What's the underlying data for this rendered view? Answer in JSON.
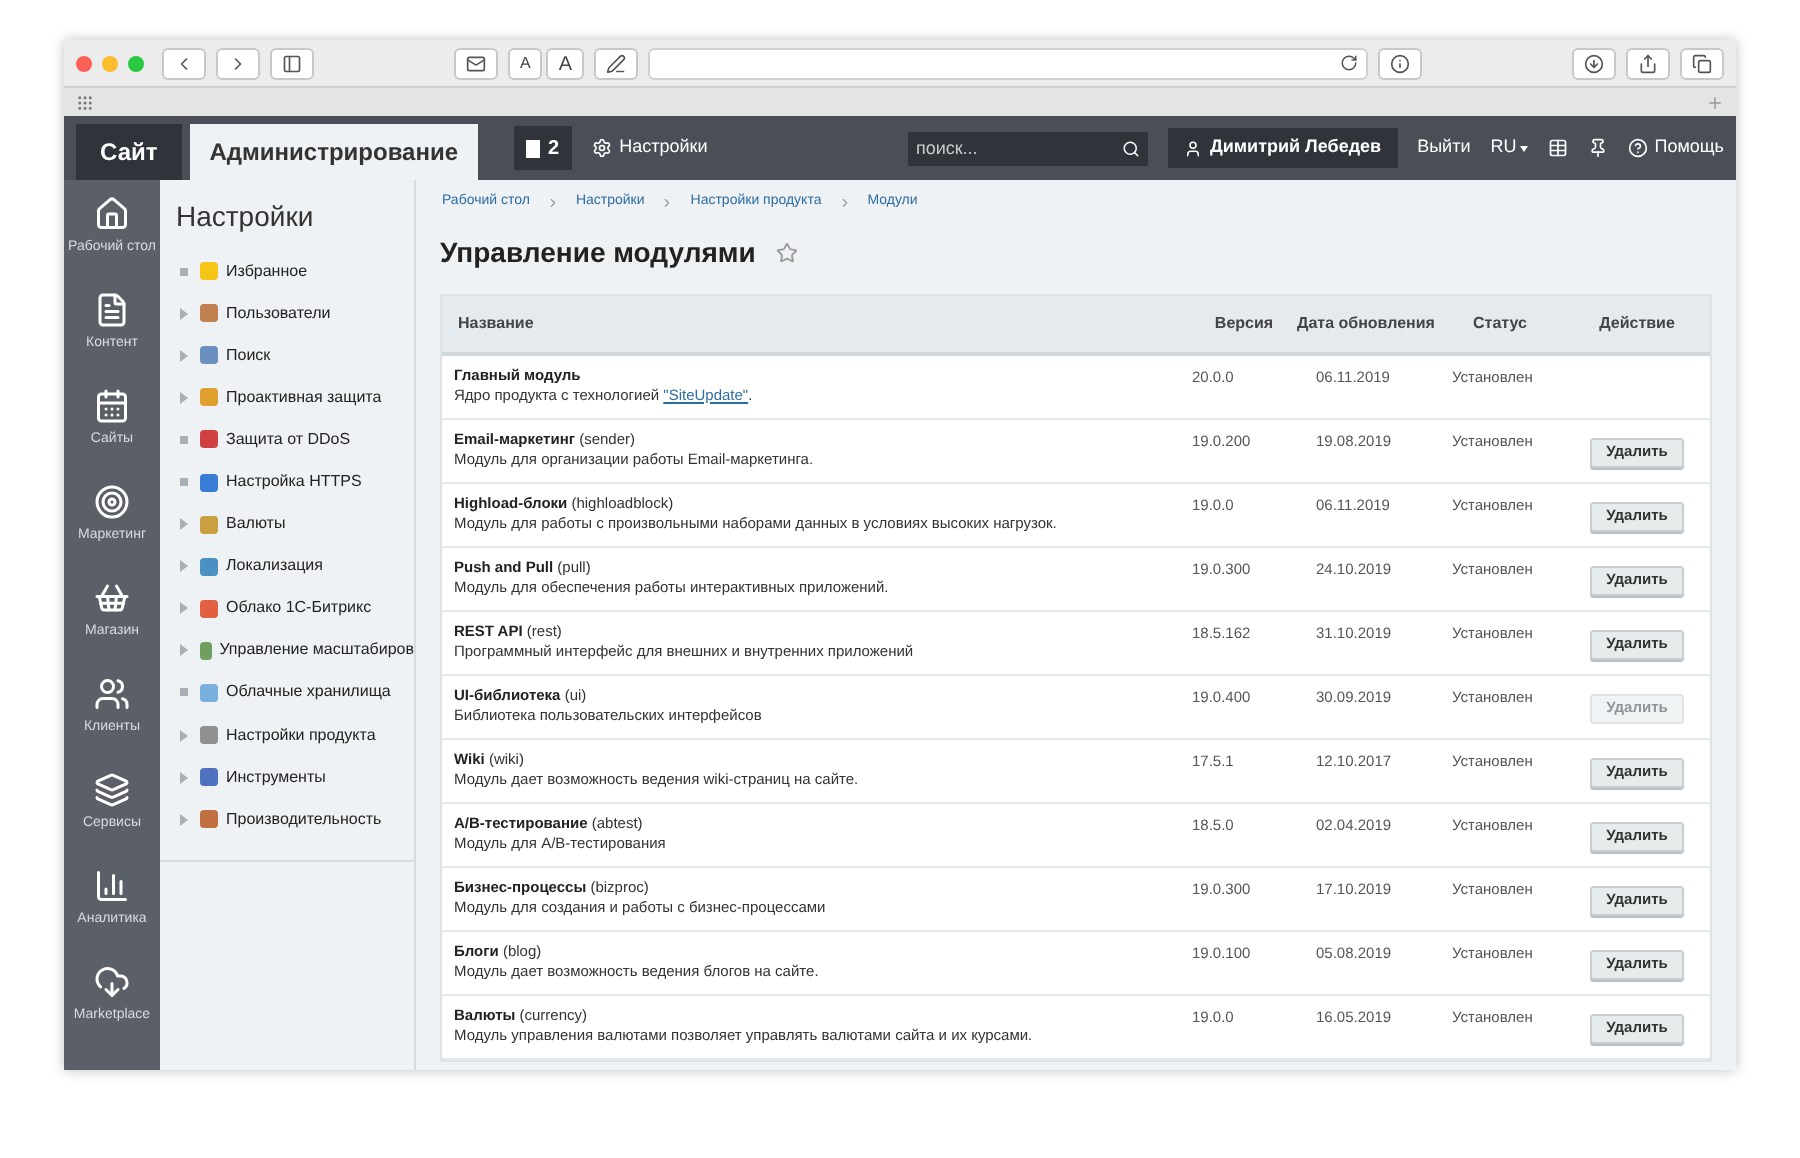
{
  "browser": {
    "text_size": [
      "A",
      "A"
    ]
  },
  "top_tabs": [
    {
      "label": "Сайт",
      "selected": false
    },
    {
      "label": "Администрирование",
      "selected": true
    }
  ],
  "header": {
    "notifications": "2",
    "settings_link": "Настройки",
    "search": {
      "placeholder": "поиск..."
    },
    "user": "Димитрий Лебедев",
    "logout": "Выйти",
    "language": "RU",
    "help": "Помощь"
  },
  "nav": [
    {
      "label": "Рабочий стол",
      "kind": "home"
    },
    {
      "label": "Контент",
      "kind": "doc"
    },
    {
      "label": "Сайты",
      "kind": "calendar"
    },
    {
      "label": "Маркетинг",
      "kind": "target"
    },
    {
      "label": "Магазин",
      "kind": "basket"
    },
    {
      "label": "Клиенты",
      "kind": "crm"
    },
    {
      "label": "Сервисы",
      "kind": "layers"
    },
    {
      "label": "Аналитика",
      "kind": "chart"
    },
    {
      "label": "Marketplace",
      "kind": "cloud"
    }
  ],
  "settings": {
    "title": "Настройки",
    "items": [
      {
        "label": "Избранное",
        "kind": "leaf"
      },
      {
        "label": "Пользователи",
        "kind": "folder"
      },
      {
        "label": "Поиск",
        "kind": "folder"
      },
      {
        "label": "Проактивная защита",
        "kind": "folder"
      },
      {
        "label": "Защита от DDoS",
        "kind": "leaf"
      },
      {
        "label": "Настройка HTTPS",
        "kind": "leaf"
      },
      {
        "label": "Валюты",
        "kind": "folder"
      },
      {
        "label": "Локализация",
        "kind": "folder"
      },
      {
        "label": "Облако 1С-Битрикс",
        "kind": "folder"
      },
      {
        "label": "Управление масштабиров",
        "kind": "folder"
      },
      {
        "label": "Облачные хранилища",
        "kind": "leaf"
      },
      {
        "label": "Настройки продукта",
        "kind": "folder"
      },
      {
        "label": "Инструменты",
        "kind": "folder"
      },
      {
        "label": "Производительность",
        "kind": "folder"
      }
    ]
  },
  "breadcrumbs": [
    "Рабочий стол",
    "Настройки",
    "Настройки продукта",
    "Модули"
  ],
  "page_title": "Управление модулями",
  "table": {
    "columns": [
      "Название",
      "Версия",
      "Дата обновления",
      "Статус",
      "Действие"
    ],
    "rows": [
      {
        "name": "Главный модуль",
        "code": "",
        "description": "Ядро продукта с технологией ",
        "link": "\"SiteUpdate\"",
        "suffix": ".",
        "version": "20.0.0",
        "date": "06.11.2019",
        "status": "Установлен"
      },
      {
        "name": "Email-маркетинг",
        "code": "(sender)",
        "description": "Модуль для организации работы Email-маркетинга.",
        "version": "19.0.200",
        "date": "19.08.2019",
        "status": "Установлен",
        "action": {
          "label": "Удалить",
          "disabled": false
        }
      },
      {
        "name": "Highload-блоки",
        "code": "(highloadblock)",
        "description": "Модуль для работы с произвольными наборами данных в условиях высоких нагрузок.",
        "version": "19.0.0",
        "date": "06.11.2019",
        "status": "Установлен",
        "action": {
          "label": "Удалить",
          "disabled": false
        }
      },
      {
        "name": "Push and Pull",
        "code": "(pull)",
        "description": "Модуль для обеспечения работы интерактивных приложений.",
        "version": "19.0.300",
        "date": "24.10.2019",
        "status": "Установлен",
        "action": {
          "label": "Удалить",
          "disabled": false
        }
      },
      {
        "name": "REST API",
        "code": "(rest)",
        "description": "Программный интерфейс для внешних и внутренних приложений",
        "version": "18.5.162",
        "date": "31.10.2019",
        "status": "Установлен",
        "action": {
          "label": "Удалить",
          "disabled": false
        }
      },
      {
        "name": "UI-библиотека",
        "code": "(ui)",
        "description": "Библиотека пользовательских интерфейсов",
        "version": "19.0.400",
        "date": "30.09.2019",
        "status": "Установлен",
        "action": {
          "label": "Удалить",
          "disabled": true
        }
      },
      {
        "name": "Wiki",
        "code": "(wiki)",
        "description": "Модуль дает возможность ведения wiki-страниц на сайте.",
        "version": "17.5.1",
        "date": "12.10.2017",
        "status": "Установлен",
        "action": {
          "label": "Удалить",
          "disabled": false
        }
      },
      {
        "name": "A/B-тестирование",
        "code": "(abtest)",
        "description": "Модуль для A/B-тестирования",
        "version": "18.5.0",
        "date": "02.04.2019",
        "status": "Установлен",
        "action": {
          "label": "Удалить",
          "disabled": false
        }
      },
      {
        "name": "Бизнес-процессы",
        "code": "(bizproc)",
        "description": "Модуль для создания и работы с бизнес-процессами",
        "version": "19.0.300",
        "date": "17.10.2019",
        "status": "Установлен",
        "action": {
          "label": "Удалить",
          "disabled": false
        }
      },
      {
        "name": "Блоги",
        "code": "(blog)",
        "description": "Модуль дает возможность ведения блогов на сайте.",
        "version": "19.0.100",
        "date": "05.08.2019",
        "status": "Установлен",
        "action": {
          "label": "Удалить",
          "disabled": false
        }
      },
      {
        "name": "Валюты",
        "code": "(currency)",
        "description": "Модуль управления валютами позволяет управлять валютами сайта и их курсами.",
        "version": "19.0.0",
        "date": "16.05.2019",
        "status": "Установлен",
        "action": {
          "label": "Удалить",
          "disabled": false
        }
      }
    ]
  }
}
